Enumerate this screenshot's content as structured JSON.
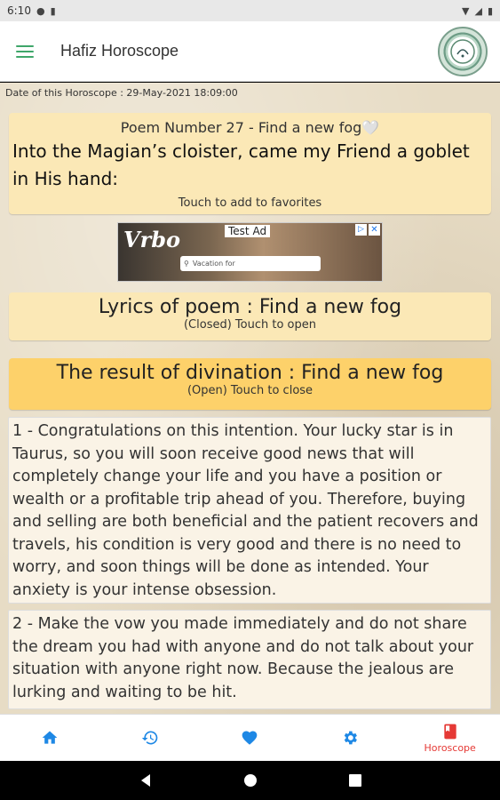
{
  "status_bar": {
    "time": "6:10"
  },
  "app_bar": {
    "title": "Hafiz Horoscope"
  },
  "date_line": "Date of this Horoscope : 29-May-2021 18:09:00",
  "poem_card": {
    "number_title": "Poem Number 27 - Find a new fog🤍",
    "first_line": "Into the Magian’s cloister, came my Friend a goblet in His hand:",
    "hint": "Touch to add to favorites"
  },
  "ad": {
    "brand": "Vrbo",
    "label": "Test Ad",
    "search_placeholder": "Vacation for"
  },
  "lyrics_card": {
    "title": "Lyrics of poem : Find a new fog",
    "state": "(Closed) Touch to open"
  },
  "result_card": {
    "title": "The result of divination : Find a new fog",
    "state": "(Open) Touch to close"
  },
  "result_paragraphs": [
    "1 - Congratulations on this intention. Your lucky star is in Taurus, so you will soon receive good news that will completely change your life and you have a position or wealth or a profitable trip ahead of you. Therefore, buying and selling are both beneficial and the patient recovers and travels, his condition is very good and there is no need to worry, and soon things will be done as intended. Your anxiety is your intense obsession.",
    "2 - Make the vow you made immediately and do not share the dream you had with anyone and do not talk about your situation with anyone right now. Because the jealous are lurking and waiting to be hit."
  ],
  "bottom_nav": {
    "items": [
      {
        "icon": "home-icon"
      },
      {
        "icon": "history-icon"
      },
      {
        "icon": "heart-icon"
      },
      {
        "icon": "settings-icon"
      },
      {
        "icon": "book-icon",
        "label": "Horoscope"
      }
    ]
  },
  "colors": {
    "accent_green": "#3fa66a",
    "nav_blue": "#1e88e5",
    "active_red": "#e53935",
    "card_bg": "#fbe8b6",
    "result_header_bg": "#fdd16a"
  }
}
